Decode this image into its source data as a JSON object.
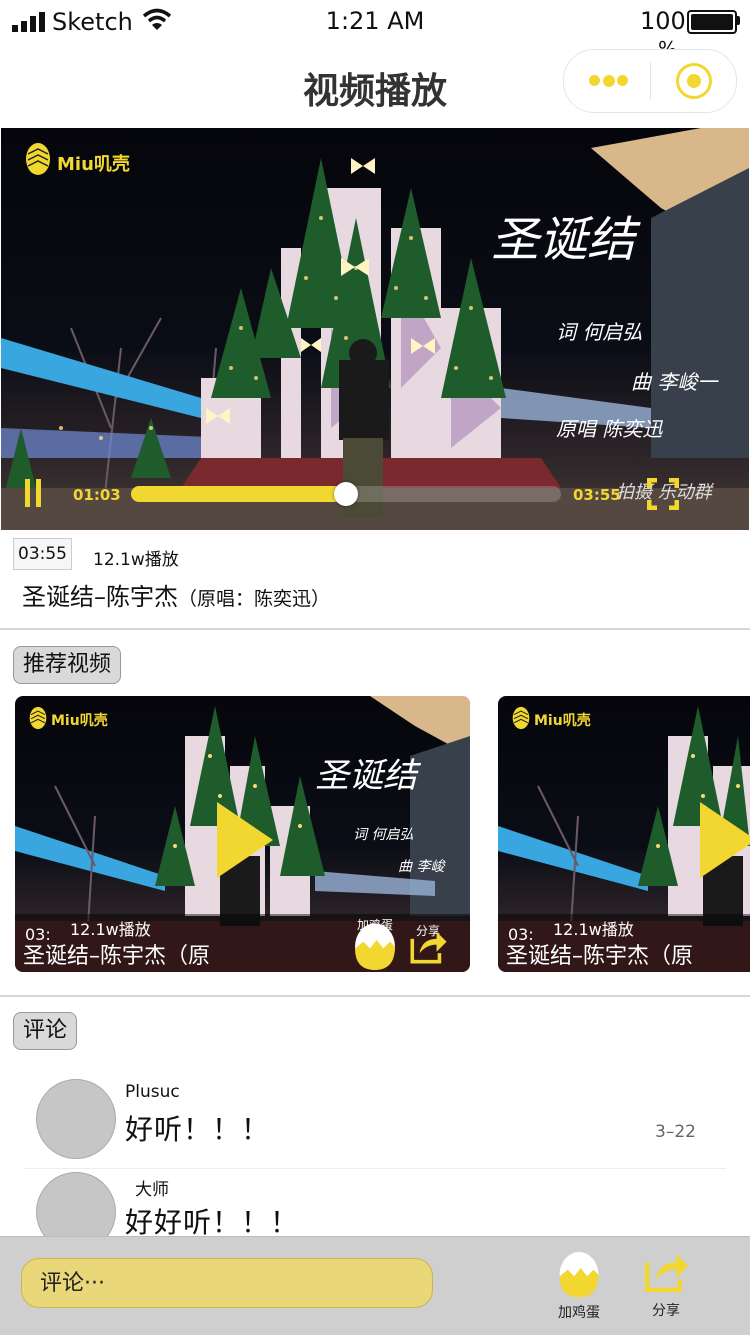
{
  "status_bar": {
    "carrier": "Sketch",
    "time": "1:21 AM",
    "battery": "100",
    "battery_unit": "%"
  },
  "nav": {
    "title": "视频播放"
  },
  "player": {
    "brand": "Miu叽壳",
    "overlay_title": "圣诞结",
    "credits": [
      "词 何启弘",
      "曲 李峻一",
      "原唱 陈奕迅"
    ],
    "credits_tail": "拍摄 乐动群",
    "current_time": "01:03",
    "total_time": "03:55",
    "progress": 0.5
  },
  "video_info": {
    "duration": "03:55",
    "plays": "12.1w播放",
    "title": "圣诞结–陈宇杰",
    "original": "（原唱：陈奕迅）"
  },
  "recommended": {
    "tag": "推荐视频",
    "cards": [
      {
        "brand": "Miu叽壳",
        "duration": "03:",
        "plays": "12.1w播放",
        "title": "圣诞结–陈宇杰（原",
        "egg_label": "加鸡蛋",
        "share_label": "分享",
        "overlay_title": "圣诞结",
        "credits": [
          "词 何启弘",
          "曲 李峻"
        ]
      },
      {
        "brand": "Miu叽壳",
        "duration": "03:",
        "plays": "12.1w播放",
        "title": "圣诞结–陈宇杰（原"
      }
    ]
  },
  "comments": {
    "tag": "评论",
    "items": [
      {
        "user": "Plusuc",
        "text": "好听！！！",
        "date": "3–22"
      },
      {
        "user": "大师",
        "text": "好好听！！！"
      }
    ]
  },
  "bottom_bar": {
    "input_placeholder": "评论···",
    "egg_label": "加鸡蛋",
    "share_label": "分享"
  },
  "colors": {
    "accent": "#f2d731",
    "input_bg": "#e9d779",
    "bottom_bar": "#cfcfcf"
  }
}
